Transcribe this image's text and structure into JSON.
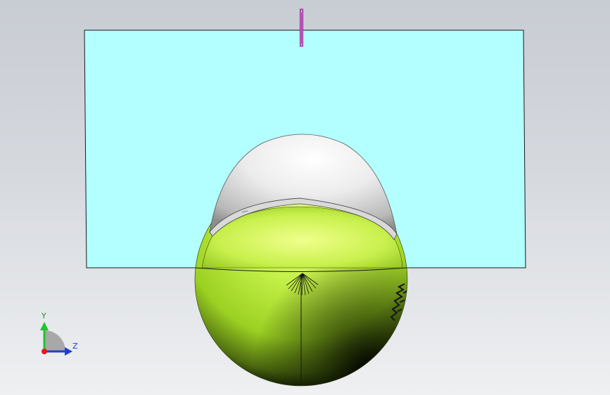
{
  "viewport": {
    "background_top": "#c8ccd3",
    "background_bottom": "#eef0f2"
  },
  "model": {
    "plane_color": "#b3ffff",
    "upper_cap_color": "#f2f2f2",
    "sphere_color": "#bff246",
    "marker_color": "#d04cd0"
  },
  "triad": {
    "y_label": "Y",
    "z_label": "Z",
    "y_color": "#22c32e",
    "z_color": "#1d3fd8",
    "origin_color": "#e01b1b"
  }
}
